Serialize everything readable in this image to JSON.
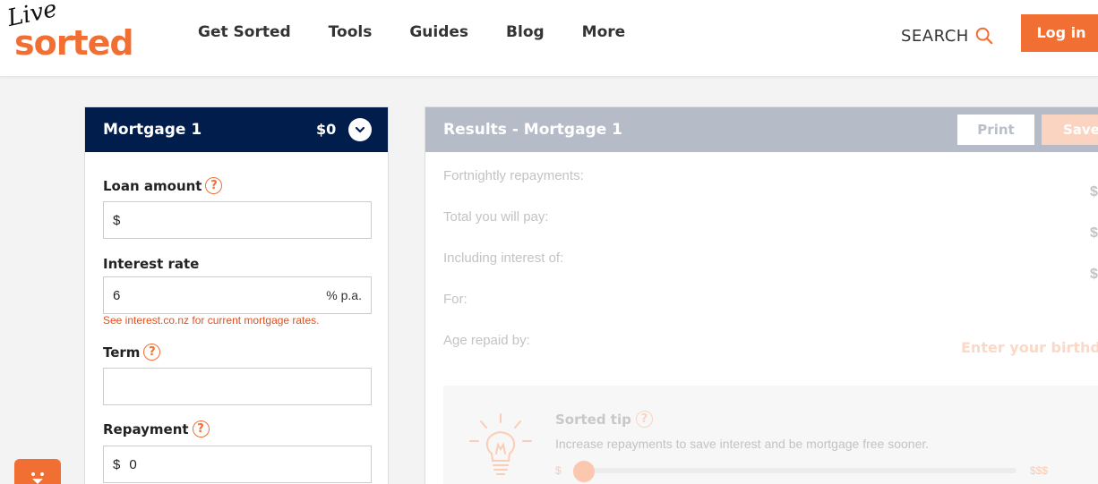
{
  "header": {
    "logo_live": "Live",
    "logo_sorted": "sorted",
    "nav": [
      "Get Sorted",
      "Tools",
      "Guides",
      "Blog",
      "More"
    ],
    "search_label": "SEARCH",
    "login_label": "Log in",
    "accent": "#f26f33"
  },
  "mortgage": {
    "title": "Mortgage 1",
    "total": "$0",
    "loan_label": "Loan amount",
    "loan_prefix": "$",
    "loan_value": "",
    "rate_label": "Interest rate",
    "rate_value": "6",
    "rate_suffix": "% p.a.",
    "rate_note": "See interest.co.nz for current mortgage rates.",
    "term_label": "Term",
    "term_value": "",
    "repayment_label": "Repayment",
    "repayment_prefix": "$",
    "repayment_value": "0",
    "help_glyph": "?",
    "header_color": "#011d4b"
  },
  "results": {
    "title": "Results - Mortgage 1",
    "print_label": "Print",
    "save_label": "Save",
    "rows": [
      {
        "label": "Fortnightly repayments:",
        "value": "$"
      },
      {
        "label": "Total you will pay:",
        "value": "$"
      },
      {
        "label": "Including interest of:",
        "value": "$"
      },
      {
        "label": "For:",
        "value": ""
      },
      {
        "label": "Age repaid by:",
        "value": ""
      }
    ],
    "birthdate_prompt": "Enter your birthdat",
    "tip": {
      "title": "Sorted tip",
      "text": "Increase repayments to save interest and be mortgage free sooner.",
      "slider_min": "$",
      "slider_max": "$$$",
      "slider_position": 0
    }
  }
}
